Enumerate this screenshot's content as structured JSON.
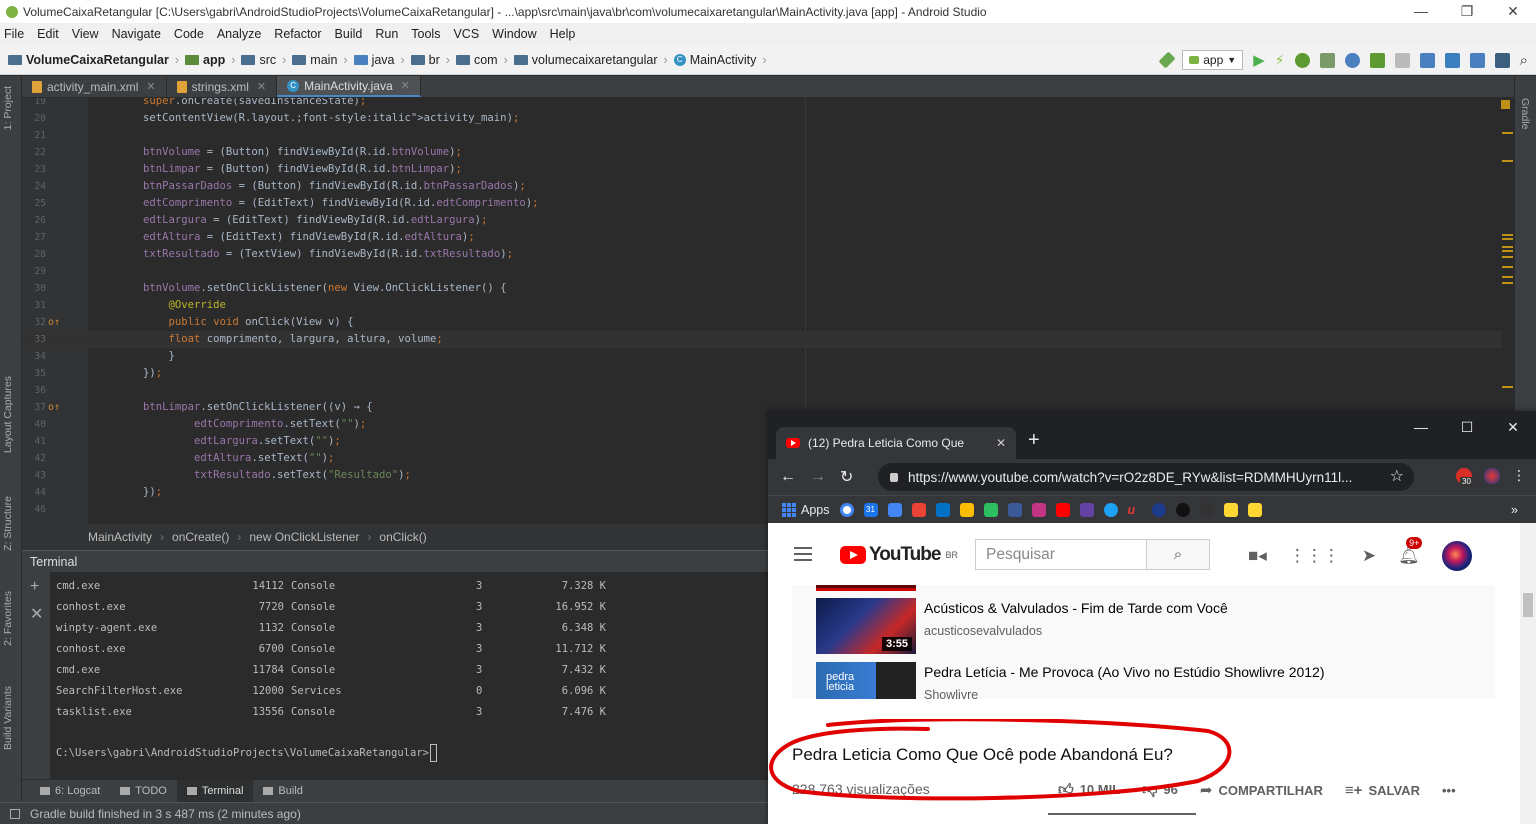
{
  "window": {
    "title": "VolumeCaixaRetangular [C:\\Users\\gabri\\AndroidStudioProjects\\VolumeCaixaRetangular] - ...\\app\\src\\main\\java\\br\\com\\volumecaixaretangular\\MainActivity.java [app] - Android Studio",
    "controls": [
      "—",
      "❐",
      "✕"
    ]
  },
  "menu": [
    "File",
    "Edit",
    "View",
    "Navigate",
    "Code",
    "Analyze",
    "Refactor",
    "Build",
    "Run",
    "Tools",
    "VCS",
    "Window",
    "Help"
  ],
  "breadcrumbs": [
    "VolumeCaixaRetangular",
    "app",
    "src",
    "main",
    "java",
    "br",
    "com",
    "volumecaixaretangular",
    "MainActivity"
  ],
  "run_config": "app",
  "editor_tabs": [
    {
      "label": "activity_main.xml",
      "active": false
    },
    {
      "label": "strings.xml",
      "active": false
    },
    {
      "label": "MainActivity.java",
      "active": true
    }
  ],
  "left_strip": [
    "1: Project",
    "Layout Captures",
    "Z: Structure",
    "2: Favorites",
    "Build Variants"
  ],
  "right_strip": [
    "Gradle"
  ],
  "code_lines": [
    {
      "n": "19",
      "text": "super.onCreate(savedInstanceState);"
    },
    {
      "n": "20",
      "text": "setContentView(R.layout.activity_main);"
    },
    {
      "n": "21",
      "text": ""
    },
    {
      "n": "22",
      "text": "btnVolume = (Button) findViewById(R.id.btnVolume);"
    },
    {
      "n": "23",
      "text": "btnLimpar = (Button) findViewById(R.id.btnLimpar);"
    },
    {
      "n": "24",
      "text": "btnPassarDados = (Button) findViewById(R.id.btnPassarDados);"
    },
    {
      "n": "25",
      "text": "edtComprimento = (EditText) findViewById(R.id.edtComprimento);"
    },
    {
      "n": "26",
      "text": "edtLargura = (EditText) findViewById(R.id.edtLargura);"
    },
    {
      "n": "27",
      "text": "edtAltura = (EditText) findViewById(R.id.edtAltura);"
    },
    {
      "n": "28",
      "text": "txtResultado = (TextView) findViewById(R.id.txtResultado);"
    },
    {
      "n": "29",
      "text": ""
    },
    {
      "n": "30",
      "text": "btnVolume.setOnClickListener(new View.OnClickListener() {"
    },
    {
      "n": "31",
      "text": "    @Override"
    },
    {
      "n": "32",
      "text": "    public void onClick(View v) {"
    },
    {
      "n": "33",
      "text": "    float comprimento, largura, altura, volume;"
    },
    {
      "n": "34",
      "text": "    }"
    },
    {
      "n": "35",
      "text": "});"
    },
    {
      "n": "36",
      "text": ""
    },
    {
      "n": "37",
      "text": "btnLimpar.setOnClickListener((v) → {"
    },
    {
      "n": "40",
      "text": "        edtComprimento.setText(\"\");"
    },
    {
      "n": "41",
      "text": "        edtLargura.setText(\"\");"
    },
    {
      "n": "42",
      "text": "        edtAltura.setText(\"\");"
    },
    {
      "n": "43",
      "text": "        txtResultado.setText(\"Resultado\");"
    },
    {
      "n": "44",
      "text": "});"
    },
    {
      "n": "46",
      "text": ""
    }
  ],
  "editor_crumb": [
    "MainActivity",
    "onCreate()",
    "new OnClickListener",
    "onClick()"
  ],
  "terminal": {
    "title": "Terminal",
    "rows": [
      [
        "cmd.exe",
        "14112",
        "Console",
        "3",
        "7.328 K"
      ],
      [
        "conhost.exe",
        "7720",
        "Console",
        "3",
        "16.952 K"
      ],
      [
        "winpty-agent.exe",
        "1132",
        "Console",
        "3",
        "6.348 K"
      ],
      [
        "conhost.exe",
        "6700",
        "Console",
        "3",
        "11.712 K"
      ],
      [
        "cmd.exe",
        "11784",
        "Console",
        "3",
        "7.432 K"
      ],
      [
        "SearchFilterHost.exe",
        "12000",
        "Services",
        "0",
        "6.096 K"
      ],
      [
        "tasklist.exe",
        "13556",
        "Console",
        "3",
        "7.476 K"
      ]
    ],
    "prompt": "C:\\Users\\gabri\\AndroidStudioProjects\\VolumeCaixaRetangular>"
  },
  "bottom_tabs": [
    "6: Logcat",
    "TODO",
    "Terminal",
    "Build"
  ],
  "status": "Gradle build finished in 3 s 487 ms (2 minutes ago)",
  "chrome": {
    "tab_title": "(12) Pedra Leticia Como Que",
    "url": "https://www.youtube.com/watch?v=rO2z8DE_RYw&list=RDMMHUyrn11l...",
    "ext_badge": "30",
    "apps_label": "Apps",
    "calendar_day": "31",
    "win_controls": [
      "—",
      "☐",
      "✕"
    ]
  },
  "youtube": {
    "logo_text": "YouTube",
    "region": "BR",
    "search_placeholder": "Pesquisar",
    "notif_count": "9+",
    "videos": [
      {
        "title": "Acústicos & Valvulados - Fim de Tarde com Você",
        "channel": "acusticosevalvulados",
        "duration": "3:55"
      },
      {
        "title": "Pedra Letícia - Me Provoca (Ao Vivo no Estúdio Showlivre 2012)",
        "channel": "Showlivre",
        "thumb_text": "pedra\nleticia"
      }
    ],
    "video_title": "Pedra Leticia Como Que Ocê pode Abandoná Eu?",
    "views": "228.763 visualizações",
    "likes": "10 MIL",
    "dislikes": "96",
    "share": "COMPARTILHAR",
    "save": "SALVAR",
    "more": "•••"
  },
  "colors": {
    "ide_bg": "#2b2b2b",
    "keyword": "#cc7832",
    "field": "#9876aa",
    "string": "#6a8759",
    "annotation": "#bbb529",
    "annotation_circle": "#e00000",
    "yt_red": "#ff0000"
  }
}
